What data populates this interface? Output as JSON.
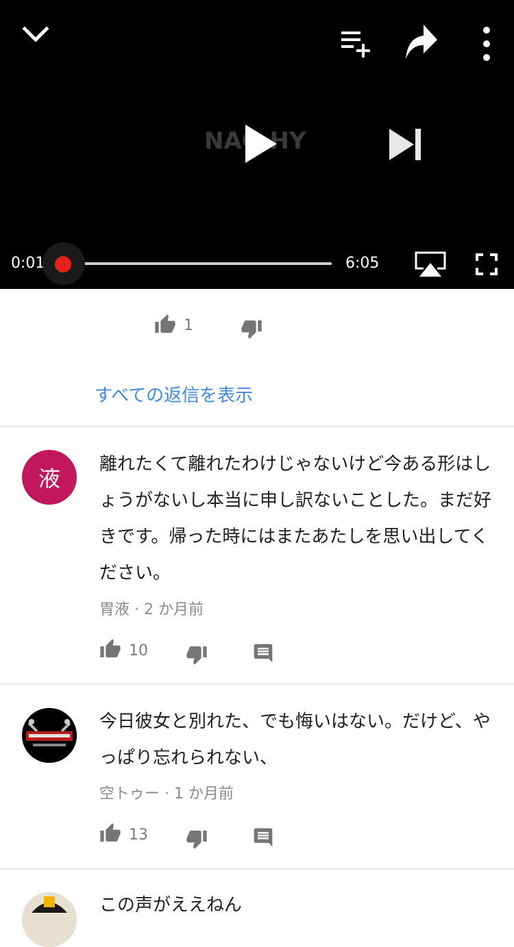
{
  "player": {
    "watermark": "NAO HY",
    "current_time": "0:01",
    "duration": "6:05",
    "progress": 0.003,
    "icons": [
      "chevron-down-icon",
      "add-to-playlist-icon",
      "share-icon",
      "more-vert-icon",
      "play-icon",
      "skip-next-icon",
      "airplay-icon",
      "fullscreen-icon"
    ],
    "accent": "#e62117"
  },
  "prev_reply": {
    "like_count": "1",
    "view_all_replies": "すべての返信を表示"
  },
  "comments": [
    {
      "avatar_text": "液",
      "avatar_color": "#c2185b",
      "text": "離れたくて離れたわけじゃないけど今ある形はしょうがないし本当に申し訳ないことした。まだ好きです。帰った時にはまたあたしを思い出してください。",
      "author": "胃液",
      "time": "2 か月前",
      "likes": "10"
    },
    {
      "text": "今日彼女と別れた、でも悔いはない。だけど、やっぱり忘れられない、",
      "author": "空トゥー",
      "time": "1 か月前",
      "likes": "13"
    },
    {
      "text": "この声がええねん"
    }
  ],
  "meta_separator": "·",
  "link_color": "#3f8ae0"
}
